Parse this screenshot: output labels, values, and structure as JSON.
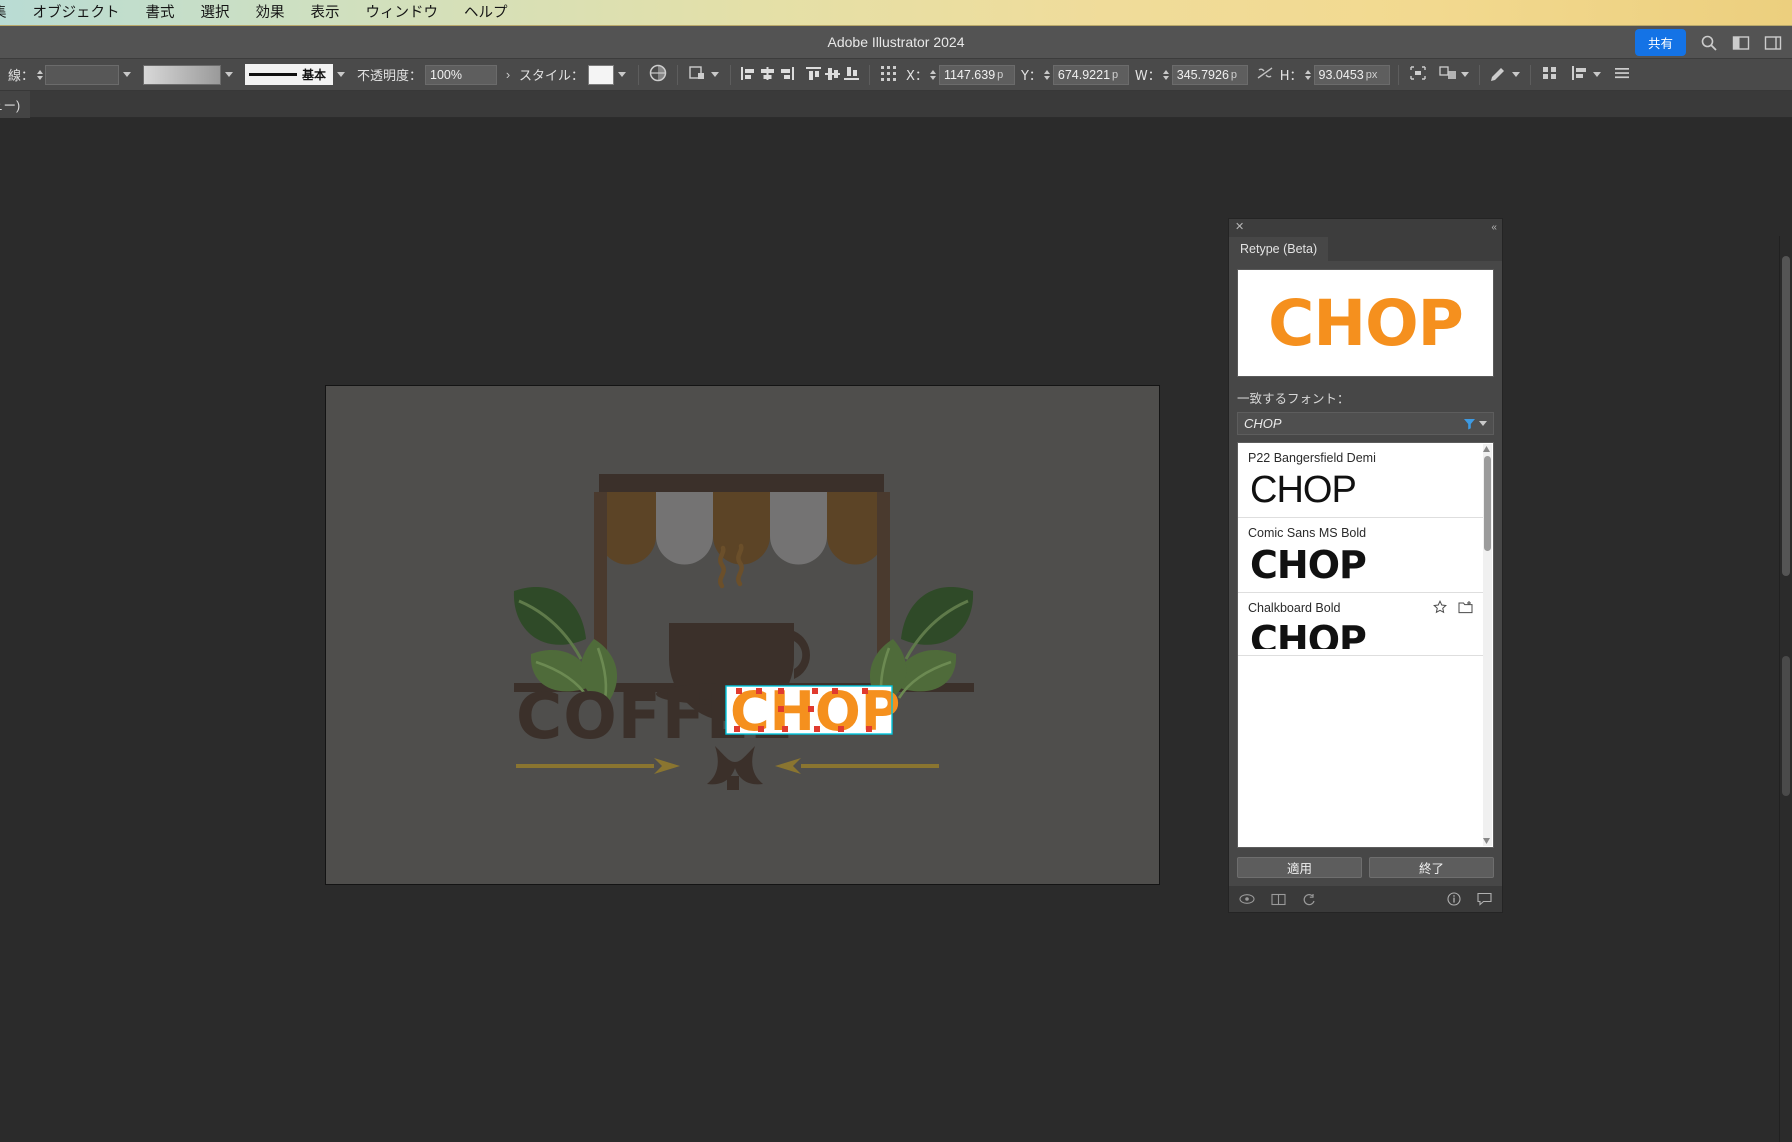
{
  "menubar": {
    "items": [
      {
        "label": "集",
        "name": "menu-edit"
      },
      {
        "label": "オブジェクト",
        "name": "menu-object"
      },
      {
        "label": "書式",
        "name": "menu-type"
      },
      {
        "label": "選択",
        "name": "menu-select"
      },
      {
        "label": "効果",
        "name": "menu-effect"
      },
      {
        "label": "表示",
        "name": "menu-view"
      },
      {
        "label": "ウィンドウ",
        "name": "menu-window"
      },
      {
        "label": "ヘルプ",
        "name": "menu-help"
      }
    ]
  },
  "titlebar": {
    "app_title": "Adobe Illustrator 2024",
    "share_label": "共有"
  },
  "control_bar": {
    "stroke_label": "線：",
    "stroke_width_value": "",
    "profile_label": "基本",
    "opacity_label": "不透明度：",
    "opacity_value": "100%",
    "style_label": "スタイル：",
    "x_label": "X：",
    "x_value": "1147.639",
    "x_unit": "p",
    "y_label": "Y：",
    "y_value": "674.9221",
    "y_unit": "p",
    "w_label": "W：",
    "w_value": "345.7926",
    "w_unit": "p",
    "h_label": "H：",
    "h_value": "93.0453",
    "h_unit": "px"
  },
  "docbar": {
    "tab_label": "/プレビュー)"
  },
  "retype_panel": {
    "tab_label": "Retype (Beta)",
    "preview_text": "CHOP",
    "preview_color": "#F5901E",
    "match_label": "一致するフォント：",
    "search_value": "CHOP",
    "fonts": [
      {
        "name": "P22 Bangersfield Demi",
        "sample": "CHOP"
      },
      {
        "name": "Comic Sans MS Bold",
        "sample": "CHOP"
      },
      {
        "name": "Chalkboard Bold",
        "sample": "CHOP"
      }
    ],
    "apply_label": "適用",
    "done_label": "終了"
  },
  "artwork": {
    "word_primary": "COFFEE",
    "word_selected": "CHOP",
    "primary_color": "#3B302A",
    "selected_color": "#F5901E",
    "awning_dark": "#5C4426",
    "awning_light": "#8A8A8A",
    "leaf_dark": "#2F4A28",
    "leaf_light": "#4F6B3A",
    "arrow_color": "#8A7530",
    "selection_color": "#00C6DE"
  }
}
